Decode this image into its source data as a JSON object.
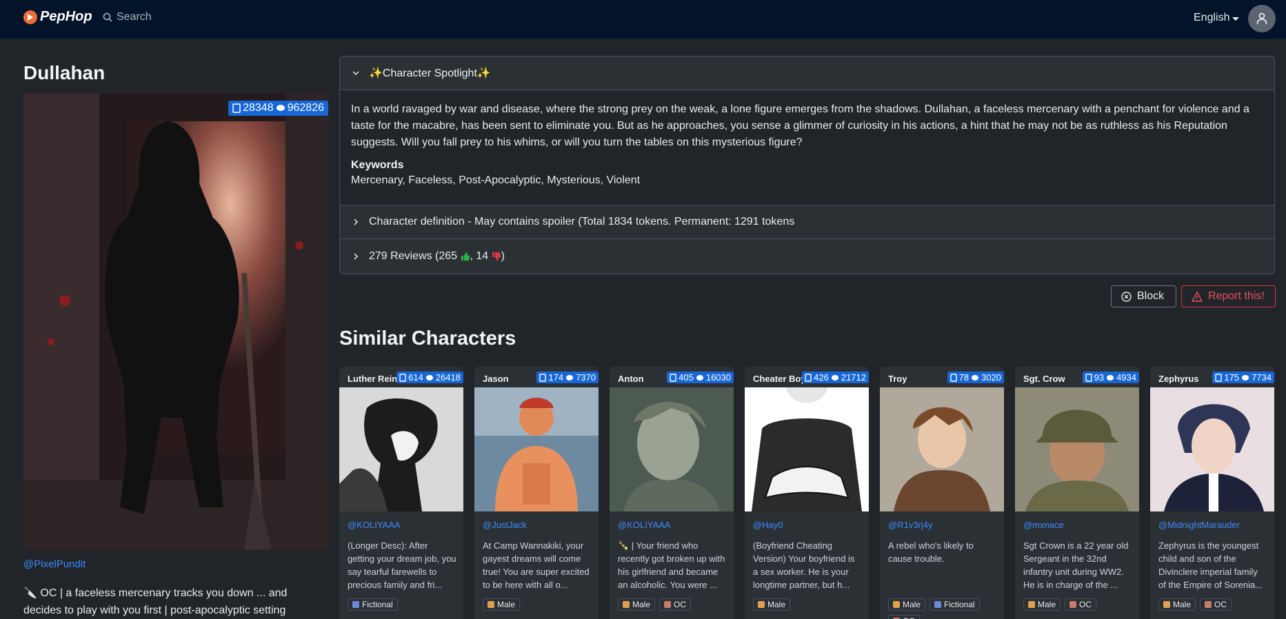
{
  "nav": {
    "brand": "PepHop",
    "search_label": "Search",
    "language": "English"
  },
  "character": {
    "name": "Dullahan",
    "chats": "28348",
    "messages": "962826",
    "creator": "@PixelPundit",
    "tagline": "🔪 OC | a faceless mercenary tracks you down ... and decides to play with you first | post-apocalyptic setting"
  },
  "spotlight": {
    "header": "✨Character Spotlight✨",
    "description": "In a world ravaged by war and disease, where the strong prey on the weak, a lone figure emerges from the shadows. Dullahan, a faceless mercenary with a penchant for violence and a taste for the macabre, has been sent to eliminate you. But as he approaches, you sense a glimmer of curiosity in his actions, a hint that he may not be as ruthless as his Reputation suggests. Will you fall prey to his whims, or will you turn the tables on this mysterious figure?",
    "keywords_label": "Keywords",
    "keywords": "Mercenary, Faceless, Post-Apocalyptic, Mysterious, Violent"
  },
  "definition_row": "Character definition - May contains spoiler (Total 1834 tokens. Permanent: 1291 tokens",
  "reviews": {
    "prefix": "279 Reviews (265 ",
    "middle": ", 14 ",
    "suffix": ")"
  },
  "actions": {
    "block": "Block",
    "report": "Report this!"
  },
  "similar_title": "Similar Characters",
  "cards": [
    {
      "name": "Luther Reinhardt",
      "chats": "614",
      "messages": "26418",
      "creator": "@KOLIYAAA",
      "desc": "(Longer Desc): After getting your dream job, you say tearful farewells to precious family and fri...",
      "tags": [
        "Fictional"
      ]
    },
    {
      "name": "Jason",
      "chats": "174",
      "messages": "7370",
      "creator": "@JustJack",
      "desc": "At Camp Wannakiki, your gayest dreams will come true! You are super excited to be here with all o...",
      "tags": [
        "Male"
      ]
    },
    {
      "name": "Anton",
      "chats": "405",
      "messages": "16030",
      "creator": "@KOLIYAAA",
      "desc": "🍾 | Your friend who recently got broken up with his girlfriend and became an alcoholic. You were ...",
      "tags": [
        "Male",
        "OC"
      ]
    },
    {
      "name": "Cheater Boyfriend",
      "chats": "426",
      "messages": "21712",
      "creator": "@Hay0",
      "desc": "(Boyfriend Cheating Version) Your boyfriend is a sex worker. He is your longtime partner, but h...",
      "tags": [
        "Male"
      ]
    },
    {
      "name": "Troy",
      "chats": "78",
      "messages": "3020",
      "creator": "@R1v3rj4y",
      "desc": "A rebel who's likely to cause trouble.",
      "tags": [
        "Male",
        "Fictional",
        "OC"
      ]
    },
    {
      "name": "Sgt. Crow",
      "chats": "93",
      "messages": "4934",
      "creator": "@mxnace",
      "desc": "Sgt Crown is a 22 year old Sergeant in the 32nd infantry unit during WW2. He is in charge of the ...",
      "tags": [
        "Male",
        "OC"
      ]
    },
    {
      "name": "Zephyrus",
      "chats": "175",
      "messages": "7734",
      "creator": "@MidnightMarauder",
      "desc": "Zephyrus is the youngest child and son of the Divinclere imperial family of the Empire of Sorenia...",
      "tags": [
        "Male",
        "OC"
      ]
    }
  ],
  "colors": {
    "navbar": "#03142a",
    "background": "#212529",
    "badge": "#1767d6",
    "link": "#3d8bfd",
    "report": "#dc3545"
  },
  "icons": [
    "search-icon",
    "user-icon",
    "chat-icon",
    "message-icon",
    "chevron-down-icon",
    "chevron-right-icon",
    "thumbs-up-icon",
    "thumbs-down-icon",
    "x-circle-icon",
    "warning-icon"
  ]
}
